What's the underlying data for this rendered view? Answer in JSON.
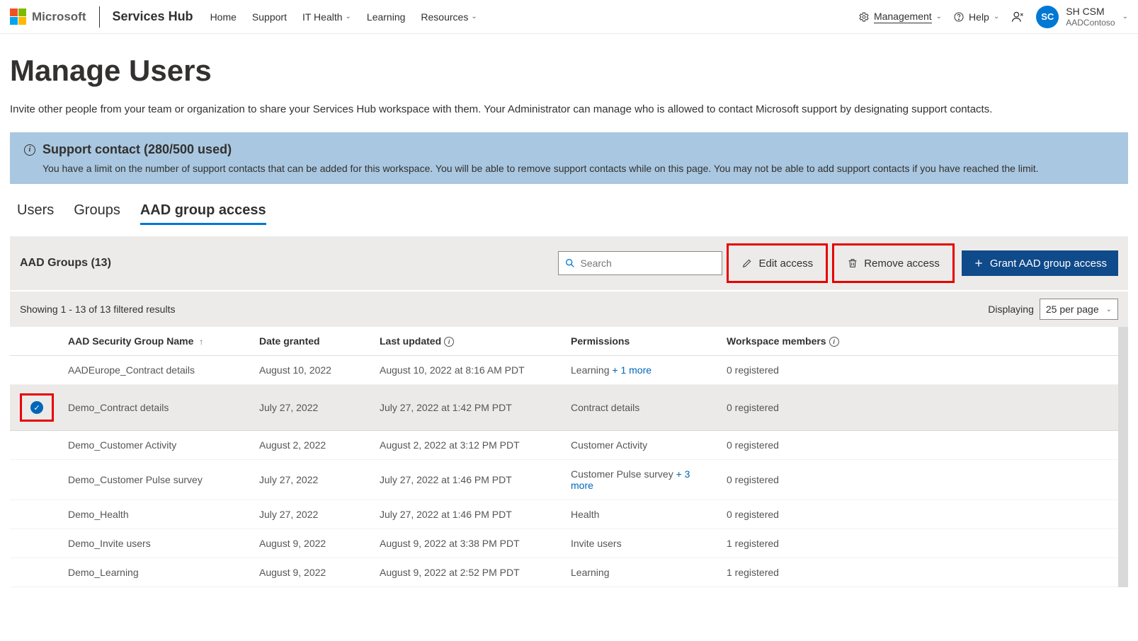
{
  "header": {
    "microsoft": "Microsoft",
    "brand": "Services Hub",
    "nav": {
      "home": "Home",
      "support": "Support",
      "ithealth": "IT Health",
      "learning": "Learning",
      "resources": "Resources"
    },
    "management": "Management",
    "help": "Help",
    "profile": {
      "initials": "SC",
      "name": "SH CSM",
      "tenant": "AADContoso"
    }
  },
  "page_title": "Manage Users",
  "subtitle": "Invite other people from your team or organization to share your Services Hub workspace with them. Your Administrator can manage who is allowed to contact Microsoft support by designating support contacts.",
  "banner": {
    "title": "Support contact (280/500 used)",
    "body": "You have a limit on the number of support contacts that can be added for this workspace. You will be able to remove support contacts while on this page. You may not be able to add support contacts if you have reached the limit."
  },
  "tabs": {
    "users": "Users",
    "groups": "Groups",
    "aad": "AAD group access"
  },
  "toolbar": {
    "title": "AAD Groups (13)",
    "search_placeholder": "Search",
    "edit": "Edit access",
    "remove": "Remove access",
    "grant": "Grant AAD group access"
  },
  "results": {
    "showing": "Showing 1 - 13 of 13 filtered results",
    "displaying": "Displaying",
    "per_page": "25 per page"
  },
  "columns": {
    "name": "AAD Security Group Name",
    "date": "Date granted",
    "updated": "Last updated",
    "perm": "Permissions",
    "members": "Workspace members"
  },
  "rows": [
    {
      "name": "AADEurope_Contract details",
      "date": "August 10, 2022",
      "updated": "August 10, 2022 at 8:16 AM PDT",
      "perm": "Learning",
      "more": " + 1 more",
      "members": "0 registered",
      "selected": false
    },
    {
      "name": "Demo_Contract details",
      "date": "July 27, 2022",
      "updated": "July 27, 2022 at 1:42 PM PDT",
      "perm": "Contract details",
      "more": "",
      "members": "0 registered",
      "selected": true
    },
    {
      "name": "Demo_Customer Activity",
      "date": "August 2, 2022",
      "updated": "August 2, 2022 at 3:12 PM PDT",
      "perm": "Customer Activity",
      "more": "",
      "members": "0 registered",
      "selected": false
    },
    {
      "name": "Demo_Customer Pulse survey",
      "date": "July 27, 2022",
      "updated": "July 27, 2022 at 1:46 PM PDT",
      "perm": "Customer Pulse survey",
      "more": " + 3 more",
      "members": "0 registered",
      "selected": false
    },
    {
      "name": "Demo_Health",
      "date": "July 27, 2022",
      "updated": "July 27, 2022 at 1:46 PM PDT",
      "perm": "Health",
      "more": "",
      "members": "0 registered",
      "selected": false
    },
    {
      "name": "Demo_Invite users",
      "date": "August 9, 2022",
      "updated": "August 9, 2022 at 3:38 PM PDT",
      "perm": "Invite users",
      "more": "",
      "members": "1 registered",
      "selected": false
    },
    {
      "name": "Demo_Learning",
      "date": "August 9, 2022",
      "updated": "August 9, 2022 at 2:52 PM PDT",
      "perm": "Learning",
      "more": "",
      "members": "1 registered",
      "selected": false
    }
  ]
}
